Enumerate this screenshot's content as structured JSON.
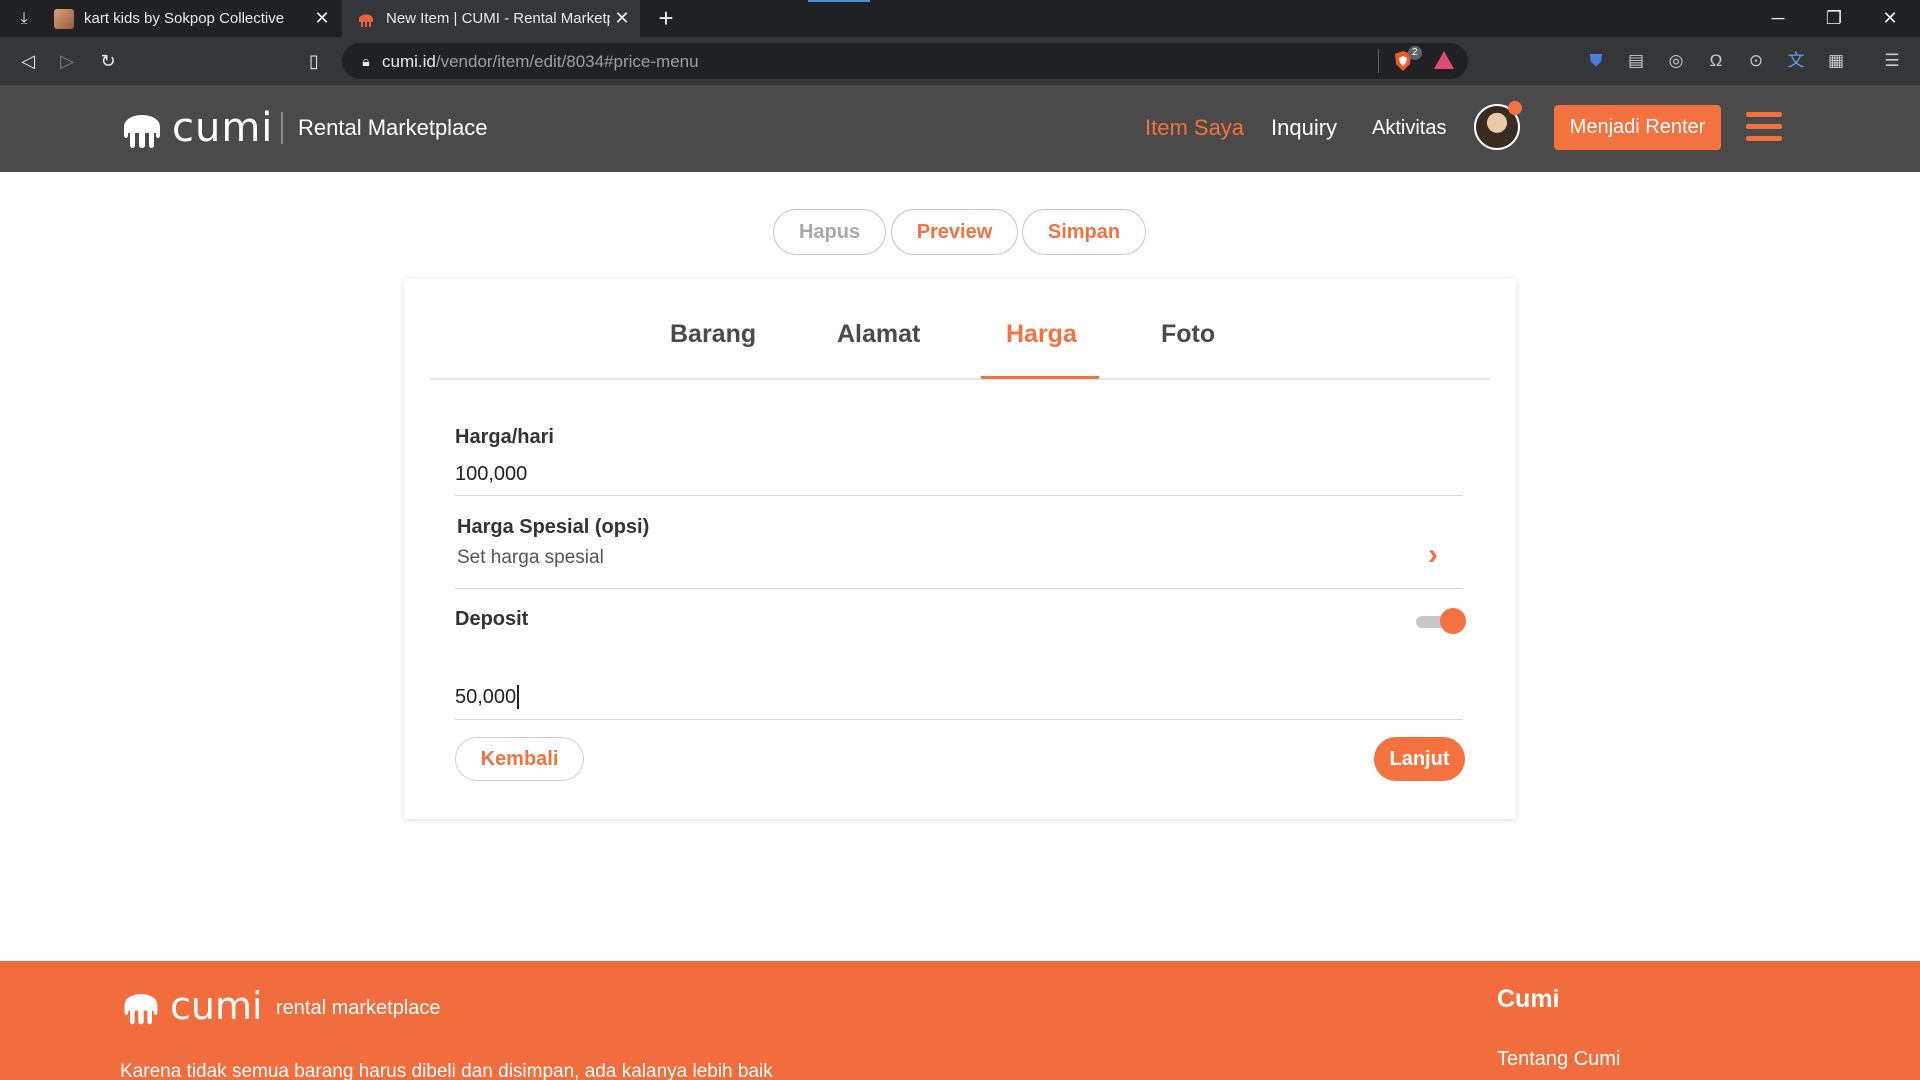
{
  "browser": {
    "tabs": [
      {
        "title": "kart kids by Sokpop Collective",
        "active": false
      },
      {
        "title": "New Item | CUMI - Rental Marketp",
        "active": true
      }
    ],
    "url_host": "cumi.id",
    "url_path": "/vendor/item/edit/8034#price-menu",
    "shield_count": "2"
  },
  "header": {
    "brand": "cumi",
    "subtitle": "Rental Marketplace",
    "nav": [
      "Item Saya",
      "Inquiry",
      "Aktivitas"
    ],
    "renter_button": "Menjadi Renter"
  },
  "actions": {
    "hapus": "Hapus",
    "preview": "Preview",
    "simpan": "Simpan"
  },
  "form_tabs": [
    "Barang",
    "Alamat",
    "Harga",
    "Foto"
  ],
  "active_tab": "Harga",
  "form": {
    "price_label": "Harga/hari",
    "price_value": "100,000",
    "special_label": "Harga Spesial (opsi)",
    "special_sub": "Set harga spesial",
    "deposit_label": "Deposit",
    "deposit_enabled": true,
    "deposit_value": "50,000",
    "back_button": "Kembali",
    "next_button": "Lanjut"
  },
  "footer": {
    "brand": "cumi",
    "tagline": "rental marketplace",
    "description": "Karena tidak semua barang harus dibeli dan disimpan, ada kalanya lebih baik",
    "column_title": "Cumi",
    "links": [
      "Tentang Cumi"
    ]
  },
  "colors": {
    "accent": "#f47140",
    "header_bg": "#4a4a4a",
    "footer_bg": "#f26d3d"
  }
}
